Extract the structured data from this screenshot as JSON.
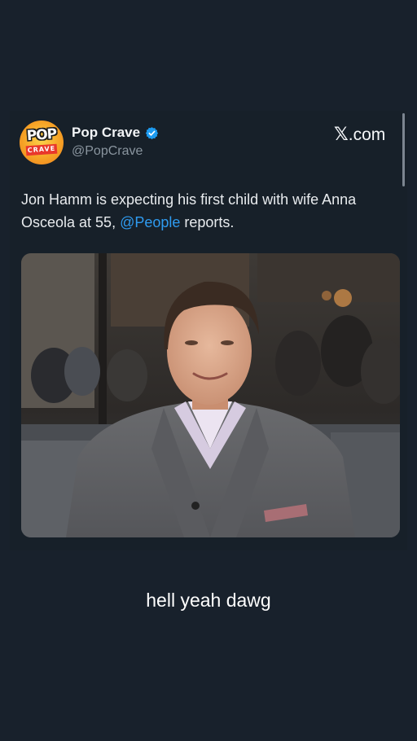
{
  "tweet": {
    "author": {
      "display_name": "Pop Crave",
      "handle": "@PopCrave",
      "verified": true,
      "avatar_text_top": "POP",
      "avatar_text_bottom": "CRAVE"
    },
    "source": {
      "text": ".com",
      "icon": "x-logo-icon"
    },
    "text_before_mention": "Jon Hamm is expecting his first child with wife Anna Osceola at 55, ",
    "mention": "@People",
    "text_after_mention": " reports.",
    "media": {
      "type": "photo",
      "icon": "photo-of-man-in-grey-suit"
    }
  },
  "caption": "hell yeah dawg",
  "colors": {
    "background": "#18212c",
    "text_primary": "#e8ebee",
    "text_secondary": "#8a959f",
    "mention": "#2f9bf0",
    "verified": "#1d9bf0"
  }
}
